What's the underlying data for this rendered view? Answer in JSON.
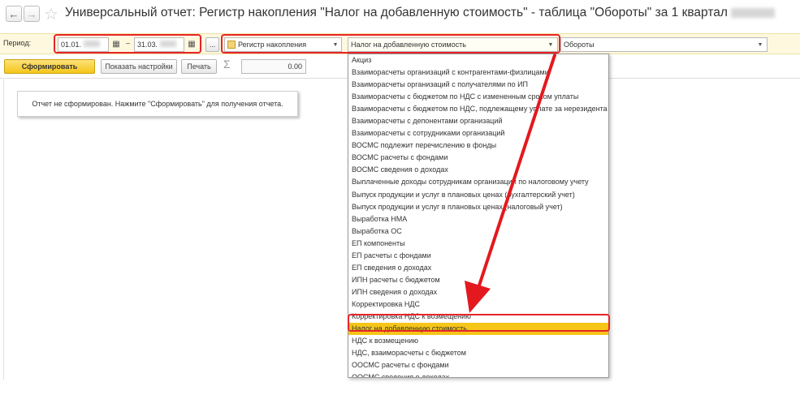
{
  "window": {
    "title": "Универсальный отчет: Регистр накопления \"Налог на добавленную стоимость\" - таблица \"Обороты\" за 1 квартал"
  },
  "nav": {
    "back": "←",
    "forward": "→",
    "star": "☆"
  },
  "filter": {
    "period_label": "Период:",
    "date_from": "01.01.",
    "date_sep": "–",
    "date_to": "31.03.",
    "more_label": "...",
    "source_type": "Регистр накопления",
    "register": "Налог на добавленную стоимость",
    "table": "Обороты"
  },
  "toolbar": {
    "generate_label": "Сформировать",
    "settings_label": "Показать настройки",
    "print_label": "Печать",
    "sum_symbol": "Σ",
    "sum_value": "0.00"
  },
  "report": {
    "message": "Отчет не сформирован. Нажмите \"Сформировать\" для получения отчета."
  },
  "dropdown": {
    "items": [
      "Акциз",
      "Взаиморасчеты организаций с контрагентами-физлицами",
      "Взаиморасчеты организаций с получателями по ИП",
      "Взаиморасчеты с бюджетом по НДС с измененным сроком уплаты",
      "Взаиморасчеты с бюджетом по НДС, подлежащему уплате за нерезидента",
      "Взаиморасчеты с депонентами организаций",
      "Взаиморасчеты с сотрудниками организаций",
      "ВОСМС подлежит перечислению в фонды",
      "ВОСМС расчеты с фондами",
      "ВОСМС сведения о доходах",
      "Выплаченные доходы сотрудникам организации по налоговому учету",
      "Выпуск продукции и услуг в плановых ценах (бухгалтерский учет)",
      "Выпуск продукции и услуг в плановых ценах (налоговый учет)",
      "Выработка НМА",
      "Выработка ОС",
      "ЕП компоненты",
      "ЕП расчеты с фондами",
      "ЕП сведения о доходах",
      "ИПН расчеты с бюджетом",
      "ИПН сведения о доходах",
      "Корректировка НДС",
      "Корректировка НДС к возмещению",
      "Налог на добавленную стоимость",
      "НДС к возмещению",
      "НДС, взаиморасчеты с бюджетом",
      "ООСМС расчеты с фондами",
      "ООСМС сведения о доходах"
    ],
    "selected_index": 22
  },
  "colors": {
    "accent_yellow": "#f5c518",
    "highlight_red": "#e8242a",
    "arrow_red": "#e3191f"
  }
}
